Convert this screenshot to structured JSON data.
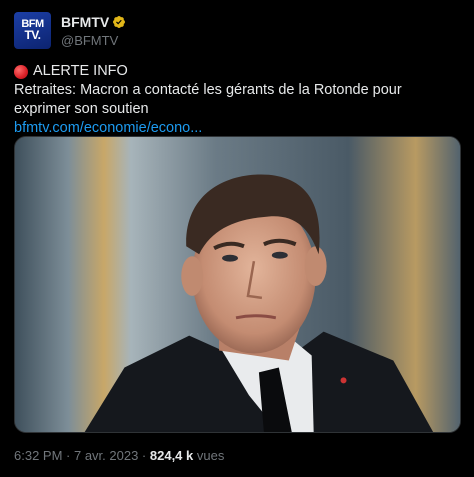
{
  "account": {
    "avatar_line1": "BFM",
    "avatar_line2": "TV.",
    "display_name": "BFMTV",
    "handle": "@BFMTV"
  },
  "tweet": {
    "alert_label": "ALERTE INFO",
    "text": "Retraites: Macron a contacté les gérants de la Rotonde pour exprimer son soutien",
    "link": "bfmtv.com/economie/econo..."
  },
  "meta": {
    "time": "6:32 PM",
    "separator": " · ",
    "date": "7 avr. 2023",
    "separator2": " · ",
    "views_count": "824,4 k",
    "views_label": " vues"
  },
  "colors": {
    "background": "#000000",
    "text": "#e7e9ea",
    "muted": "#71767b",
    "link": "#1d9bf0",
    "verified_badge": "#e2b719",
    "alert_dot": "#d91f26"
  },
  "icons": {
    "verified": "verified-badge-icon",
    "alert": "red-circle-icon"
  }
}
